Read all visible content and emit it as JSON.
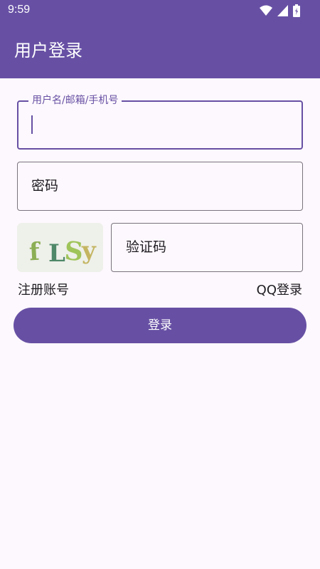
{
  "status_bar": {
    "time": "9:59",
    "icons": [
      "wifi-icon",
      "signal-icon",
      "battery-icon"
    ]
  },
  "app_bar": {
    "title": "用户登录"
  },
  "form": {
    "username": {
      "label": "用户名/邮箱/手机号",
      "value": ""
    },
    "password": {
      "placeholder": "密码"
    },
    "captcha": {
      "image_text": "fLSy",
      "placeholder": "验证码"
    },
    "register_link": "注册账号",
    "qq_login_link": "QQ登录",
    "login_button": "登录"
  },
  "colors": {
    "primary": "#6750a4",
    "background": "#fdf8fd",
    "outline": "#79747e",
    "text": "#1d1b20"
  }
}
